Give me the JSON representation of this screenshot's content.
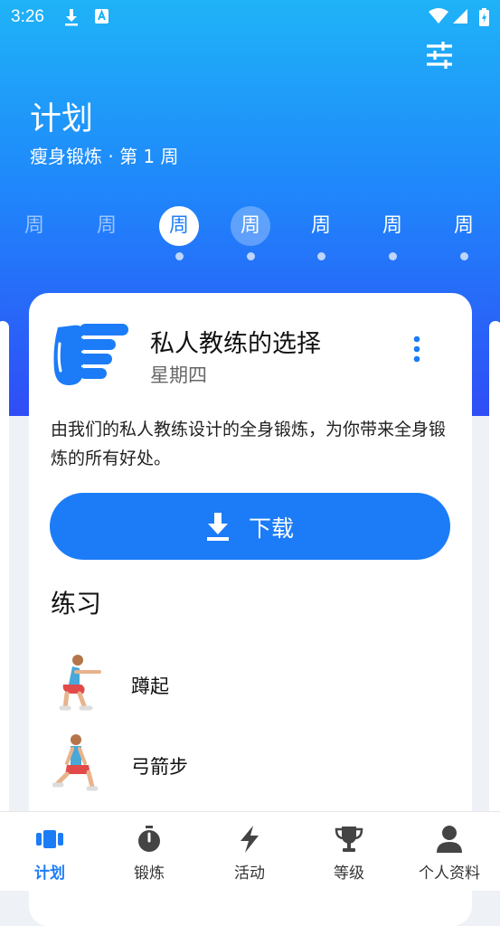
{
  "status_bar": {
    "time": "3:26"
  },
  "header": {
    "title": "计划",
    "subtitle": "瘦身锻炼 · 第 1 周"
  },
  "week": {
    "days": [
      {
        "label": "周",
        "state": "past"
      },
      {
        "label": "周",
        "state": "past"
      },
      {
        "label": "周",
        "state": "selected"
      },
      {
        "label": "周",
        "state": "today"
      },
      {
        "label": "周",
        "state": "future"
      },
      {
        "label": "周",
        "state": "future"
      },
      {
        "label": "周",
        "state": "future"
      }
    ]
  },
  "card": {
    "title": "私人教练的选择",
    "day": "星期四",
    "description": "由我们的私人教练设计的全身锻炼，为你带来全身锻炼的所有好处。",
    "download_label": "下载",
    "exercises_heading": "练习",
    "exercises": [
      {
        "name": "蹲起",
        "icon": "squat-figure"
      },
      {
        "name": "弓箭步",
        "icon": "lunge-figure"
      }
    ]
  },
  "bottom_nav": {
    "items": [
      {
        "label": "计划",
        "icon": "plan-icon",
        "active": true
      },
      {
        "label": "锻炼",
        "icon": "stopwatch-icon",
        "active": false
      },
      {
        "label": "活动",
        "icon": "lightning-icon",
        "active": false
      },
      {
        "label": "等级",
        "icon": "trophy-icon",
        "active": false
      },
      {
        "label": "个人资料",
        "icon": "person-icon",
        "active": false
      }
    ]
  },
  "colors": {
    "accent": "#1c7cf7",
    "gradient_top": "#1fb3f7",
    "gradient_bottom": "#2f4df6"
  }
}
